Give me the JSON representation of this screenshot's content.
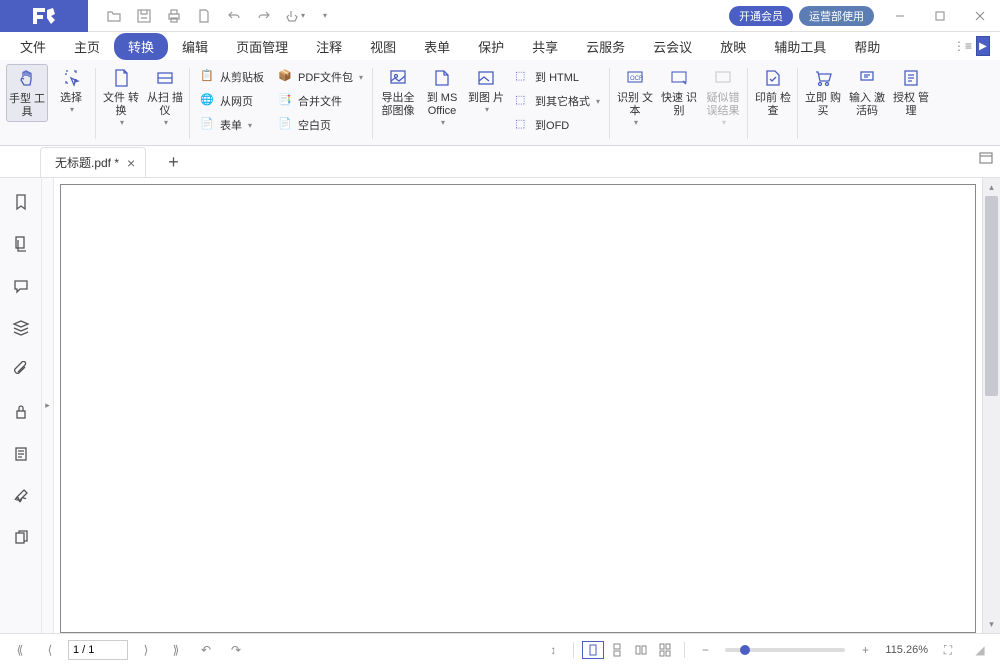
{
  "titlebar": {
    "pill1": "开通会员",
    "pill2": "运营部使用"
  },
  "menu": [
    "文件",
    "主页",
    "转换",
    "编辑",
    "页面管理",
    "注释",
    "视图",
    "表单",
    "保护",
    "共享",
    "云服务",
    "云会议",
    "放映",
    "辅助工具",
    "帮助"
  ],
  "menu_active": 2,
  "ribbon": {
    "hand": "手型\n工具",
    "select": "选择",
    "fileconv": "文件\n转换",
    "scan": "从扫\n描仪",
    "clip": "从剪贴板",
    "web": "从网页",
    "form": "表单",
    "pdfpkg": "PDF文件包",
    "merge": "合并文件",
    "blank": "空白页",
    "exportimg": "导出全\n部图像",
    "toms": "到 MS\nOffice",
    "toimg": "到图\n片",
    "tohtml": "到 HTML",
    "toother": "到其它格式",
    "toofd": "到OFD",
    "ocrtext": "识别\n文本",
    "quickocr": "快速\n识别",
    "suspect": "疑似错\n误结果",
    "preflight": "印前\n检查",
    "buy": "立即\n购买",
    "code": "输入\n激活码",
    "license": "授权\n管理"
  },
  "tab": {
    "title": "无标题.pdf *"
  },
  "status": {
    "page": "1 / 1",
    "zoom": "115.26%"
  }
}
